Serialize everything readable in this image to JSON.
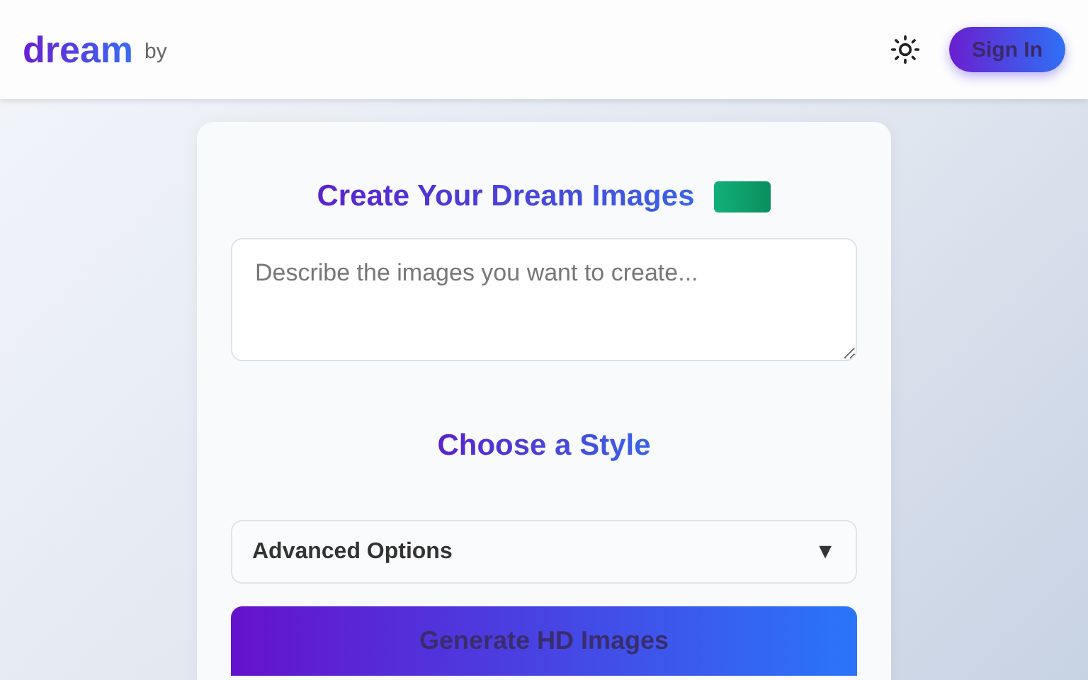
{
  "header": {
    "logo": "dream",
    "byline": "by",
    "sign_in": "Sign In"
  },
  "card": {
    "title": "Create Your Dream Images",
    "prompt": {
      "placeholder": "Describe the images you want to create..."
    },
    "style_heading": "Choose a Style",
    "advanced": {
      "label": "Advanced Options",
      "arrow": "▼",
      "expanded": false
    },
    "generate": "Generate HD Images"
  }
}
